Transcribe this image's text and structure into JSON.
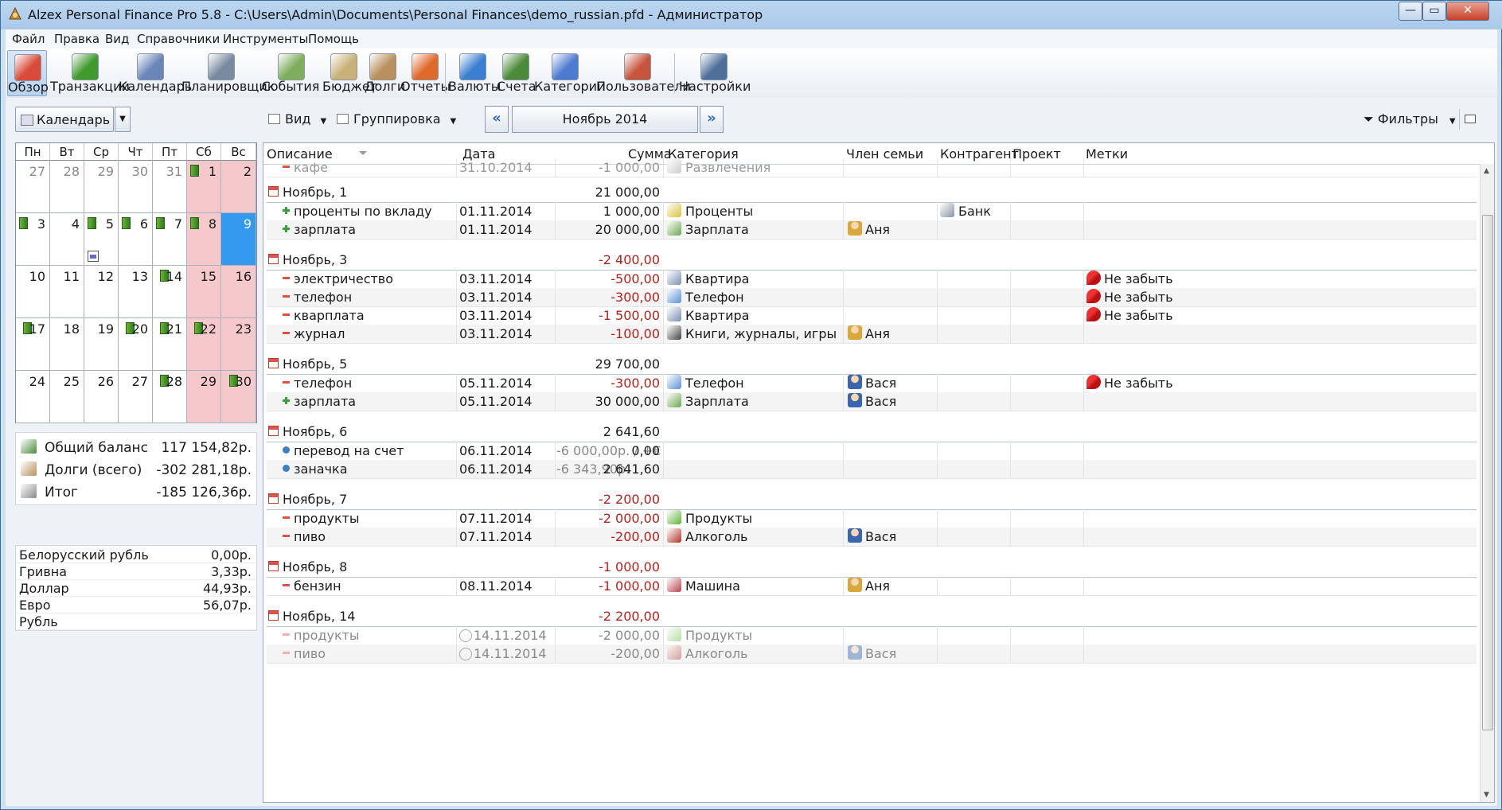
{
  "window": {
    "title": "Alzex Personal Finance Pro 5.8 - C:\\Users\\Admin\\Documents\\Personal Finances\\demo_russian.pfd - Администратор",
    "buttons": {
      "minimize": "—",
      "maximize": "▭",
      "close": "✕"
    }
  },
  "menu": [
    "Файл",
    "Правка",
    "Вид",
    "Справочники",
    "Инструменты",
    "Помощь"
  ],
  "toolbar": [
    {
      "label": "Обзор",
      "icon": "overview-icon",
      "color": "#d94b3a",
      "active": true
    },
    {
      "label": "Транзакции",
      "icon": "transactions-icon",
      "color": "#3f9a2e"
    },
    {
      "label": "Календарь",
      "icon": "calendar-icon",
      "color": "#6a86b8"
    },
    {
      "label": "Планировщик",
      "icon": "planner-icon",
      "color": "#7a8aa0"
    },
    {
      "label": "События",
      "icon": "events-icon",
      "color": "#7fae5d"
    },
    {
      "label": "Бюджет",
      "icon": "budget-icon",
      "color": "#c8b27a"
    },
    {
      "label": "Долги",
      "icon": "debts-icon",
      "color": "#b9905c"
    },
    {
      "label": "Отчеты",
      "icon": "reports-icon",
      "color": "#e06a2b"
    },
    {
      "label": "Валюты",
      "icon": "currencies-icon",
      "color": "#3b7fd0"
    },
    {
      "label": "Счета",
      "icon": "accounts-icon",
      "color": "#4b8a3a"
    },
    {
      "label": "Категории",
      "icon": "categories-icon",
      "color": "#4d7bd0"
    },
    {
      "label": "Пользователи",
      "icon": "users-icon",
      "color": "#c7553e"
    },
    {
      "label": "Настройки",
      "icon": "settings-icon",
      "color": "#4e6f9a"
    }
  ],
  "view_bar": {
    "calendar_combo": "Календарь",
    "view": "Вид",
    "grouping": "Группировка",
    "prev": "«",
    "next": "»",
    "month": "Ноябрь 2014",
    "filters": "Фильтры"
  },
  "calendar": {
    "weekdays": [
      "Пн",
      "Вт",
      "Ср",
      "Чт",
      "Пт",
      "Сб",
      "Вс"
    ],
    "weeks": [
      [
        {
          "d": "27",
          "other": true
        },
        {
          "d": "28",
          "other": true
        },
        {
          "d": "29",
          "other": true
        },
        {
          "d": "30",
          "other": true
        },
        {
          "d": "31",
          "other": true
        },
        {
          "d": "1",
          "mark": true
        },
        {
          "d": "2"
        }
      ],
      [
        {
          "d": "3",
          "mark": true
        },
        {
          "d": "4"
        },
        {
          "d": "5",
          "mark": true,
          "note": true
        },
        {
          "d": "6",
          "mark": true
        },
        {
          "d": "7",
          "mark": true
        },
        {
          "d": "8",
          "mark": true
        },
        {
          "d": "9",
          "today": true
        }
      ],
      [
        {
          "d": "10"
        },
        {
          "d": "11"
        },
        {
          "d": "12"
        },
        {
          "d": "13"
        },
        {
          "d": "14",
          "mark": true
        },
        {
          "d": "15"
        },
        {
          "d": "16"
        }
      ],
      [
        {
          "d": "17",
          "mark": true
        },
        {
          "d": "18"
        },
        {
          "d": "19"
        },
        {
          "d": "20",
          "mark": true
        },
        {
          "d": "21",
          "mark": true
        },
        {
          "d": "22",
          "mark": true
        },
        {
          "d": "23"
        }
      ],
      [
        {
          "d": "24"
        },
        {
          "d": "25"
        },
        {
          "d": "26"
        },
        {
          "d": "27"
        },
        {
          "d": "28",
          "mark": true
        },
        {
          "d": "29"
        },
        {
          "d": "30",
          "mark": true
        }
      ]
    ]
  },
  "balance": [
    {
      "label": "Общий баланс",
      "value": "117 154,82р.",
      "icon": "balance-icon"
    },
    {
      "label": "Долги (всего)",
      "value": "-302 281,18р.",
      "icon": "debts-total-icon"
    },
    {
      "label": "Итог",
      "value": "-185 126,36р.",
      "icon": "scales-icon"
    }
  ],
  "rates": [
    {
      "label": "Белорусский рубль",
      "value": "0,00р."
    },
    {
      "label": "Гривна",
      "value": "3,33р."
    },
    {
      "label": "Доллар",
      "value": "44,93р."
    },
    {
      "label": "Евро",
      "value": "56,07р."
    },
    {
      "label": "Рубль",
      "value": ""
    }
  ],
  "columns": {
    "desc": "Описание",
    "date": "Дата",
    "amount": "Сумма",
    "category": "Категория",
    "member": "Член семьи",
    "counterparty": "Контрагент",
    "project": "Проект",
    "tags": "Метки"
  },
  "items": [
    {
      "type": "row",
      "struck": true,
      "sign": "minus",
      "desc": "кафе",
      "date": "31.10.2014",
      "amount": "-1 000,00",
      "category": "Развлечения",
      "cat_icon": "entertainment-icon"
    },
    {
      "type": "group",
      "title": "Ноябрь, 1",
      "sum": "21 000,00"
    },
    {
      "type": "row",
      "sign": "plus",
      "desc": "проценты по вкладу",
      "date": "01.11.2014",
      "amount": "1 000,00",
      "category": "Проценты",
      "cat_icon": "percent-icon",
      "counterparty": "Банк",
      "cp_icon": "bank-icon"
    },
    {
      "type": "row",
      "alt": true,
      "sign": "plus",
      "desc": "зарплата",
      "date": "01.11.2014",
      "amount": "20 000,00",
      "category": "Зарплата",
      "cat_icon": "salary-icon",
      "member": "Аня",
      "mem_kind": "a"
    },
    {
      "type": "group",
      "title": "Ноябрь, 3",
      "sum": "-2 400,00",
      "neg": true
    },
    {
      "type": "row",
      "sign": "minus",
      "desc": "электричество",
      "date": "03.11.2014",
      "amount": "-500,00",
      "neg": true,
      "category": "Квартира",
      "cat_icon": "apartment-icon",
      "tag": "Не забыть"
    },
    {
      "type": "row",
      "alt": true,
      "sign": "minus",
      "desc": "телефон",
      "date": "03.11.2014",
      "amount": "-300,00",
      "neg": true,
      "category": "Телефон",
      "cat_icon": "phone-icon",
      "tag": "Не забыть"
    },
    {
      "type": "row",
      "sign": "minus",
      "desc": "кварплата",
      "date": "03.11.2014",
      "amount": "-1 500,00",
      "neg": true,
      "category": "Квартира",
      "cat_icon": "apartment-icon",
      "tag": "Не забыть"
    },
    {
      "type": "row",
      "alt": true,
      "sign": "minus",
      "desc": "журнал",
      "date": "03.11.2014",
      "amount": "-100,00",
      "neg": true,
      "category": "Книги, журналы, игры",
      "cat_icon": "books-icon",
      "member": "Аня",
      "mem_kind": "a"
    },
    {
      "type": "group",
      "title": "Ноябрь, 5",
      "sum": "29 700,00"
    },
    {
      "type": "row",
      "sign": "minus",
      "desc": "телефон",
      "date": "05.11.2014",
      "amount": "-300,00",
      "neg": true,
      "category": "Телефон",
      "cat_icon": "phone-icon",
      "member": "Вася",
      "mem_kind": "v",
      "tag": "Не забыть"
    },
    {
      "type": "row",
      "alt": true,
      "sign": "plus",
      "desc": "зарплата",
      "date": "05.11.2014",
      "amount": "30 000,00",
      "category": "Зарплата",
      "cat_icon": "salary-icon",
      "member": "Вася",
      "mem_kind": "v"
    },
    {
      "type": "group",
      "title": "Ноябрь, 6",
      "sum": "2 641,60"
    },
    {
      "type": "row",
      "sign": "transfer",
      "desc": "перевод на счет",
      "date": "06.11.2014",
      "sub": "-6 000,00р. / +€",
      "amount": "0,00"
    },
    {
      "type": "row",
      "alt": true,
      "sign": "transfer",
      "desc": "заначка",
      "date": "06.11.2014",
      "sub": "-6 343,90р.",
      "amount": "2 641,60"
    },
    {
      "type": "group",
      "title": "Ноябрь, 7",
      "sum": "-2 200,00",
      "neg": true
    },
    {
      "type": "row",
      "sign": "minus",
      "desc": "продукты",
      "date": "07.11.2014",
      "amount": "-2 000,00",
      "neg": true,
      "category": "Продукты",
      "cat_icon": "apple-icon"
    },
    {
      "type": "row",
      "alt": true,
      "sign": "minus",
      "desc": "пиво",
      "date": "07.11.2014",
      "amount": "-200,00",
      "neg": true,
      "category": "Алкоголь",
      "cat_icon": "wine-icon",
      "member": "Вася",
      "mem_kind": "v"
    },
    {
      "type": "group",
      "title": "Ноябрь, 8",
      "sum": "-1 000,00",
      "neg": true
    },
    {
      "type": "row",
      "sign": "minus",
      "desc": "бензин",
      "date": "08.11.2014",
      "amount": "-1 000,00",
      "neg": true,
      "category": "Машина",
      "cat_icon": "car-icon",
      "member": "Аня",
      "mem_kind": "a"
    },
    {
      "type": "group",
      "title": "Ноябрь, 14",
      "sum": "-2 200,00",
      "neg": true
    },
    {
      "type": "row",
      "faded": true,
      "sign": "minus",
      "desc": "продукты",
      "date": "14.11.2014",
      "scheduled": true,
      "amount": "-2 000,00",
      "category": "Продукты",
      "cat_icon": "apple-icon"
    },
    {
      "type": "row",
      "faded": true,
      "alt": true,
      "sign": "minus",
      "desc": "пиво",
      "date": "14.11.2014",
      "scheduled": true,
      "amount": "-200,00",
      "category": "Алкоголь",
      "cat_icon": "wine-icon",
      "member": "Вася",
      "mem_kind": "v"
    }
  ]
}
